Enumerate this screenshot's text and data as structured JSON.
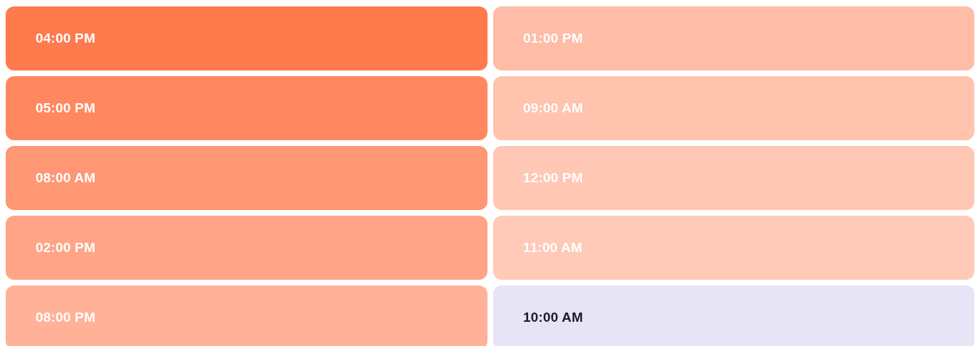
{
  "slots": [
    {
      "time": "04:00 PM",
      "color": "#ff7a4d",
      "kind": "ranked"
    },
    {
      "time": "05:00 PM",
      "color": "#ff8861",
      "kind": "ranked"
    },
    {
      "time": "08:00 AM",
      "color": "#ff9674",
      "kind": "ranked"
    },
    {
      "time": "02:00 PM",
      "color": "#ffa486",
      "kind": "ranked"
    },
    {
      "time": "08:00 PM",
      "color": "#ffb297",
      "kind": "ranked"
    },
    {
      "time": "01:00 PM",
      "color": "#ffbca7",
      "kind": "ranked"
    },
    {
      "time": "09:00 AM",
      "color": "#ffc3ae",
      "kind": "ranked"
    },
    {
      "time": "12:00 PM",
      "color": "#ffc7b4",
      "kind": "ranked"
    },
    {
      "time": "11:00 AM",
      "color": "#ffcab8",
      "kind": "ranked"
    },
    {
      "time": "10:00 AM",
      "color": "#e6e4f5",
      "kind": "plain"
    }
  ]
}
